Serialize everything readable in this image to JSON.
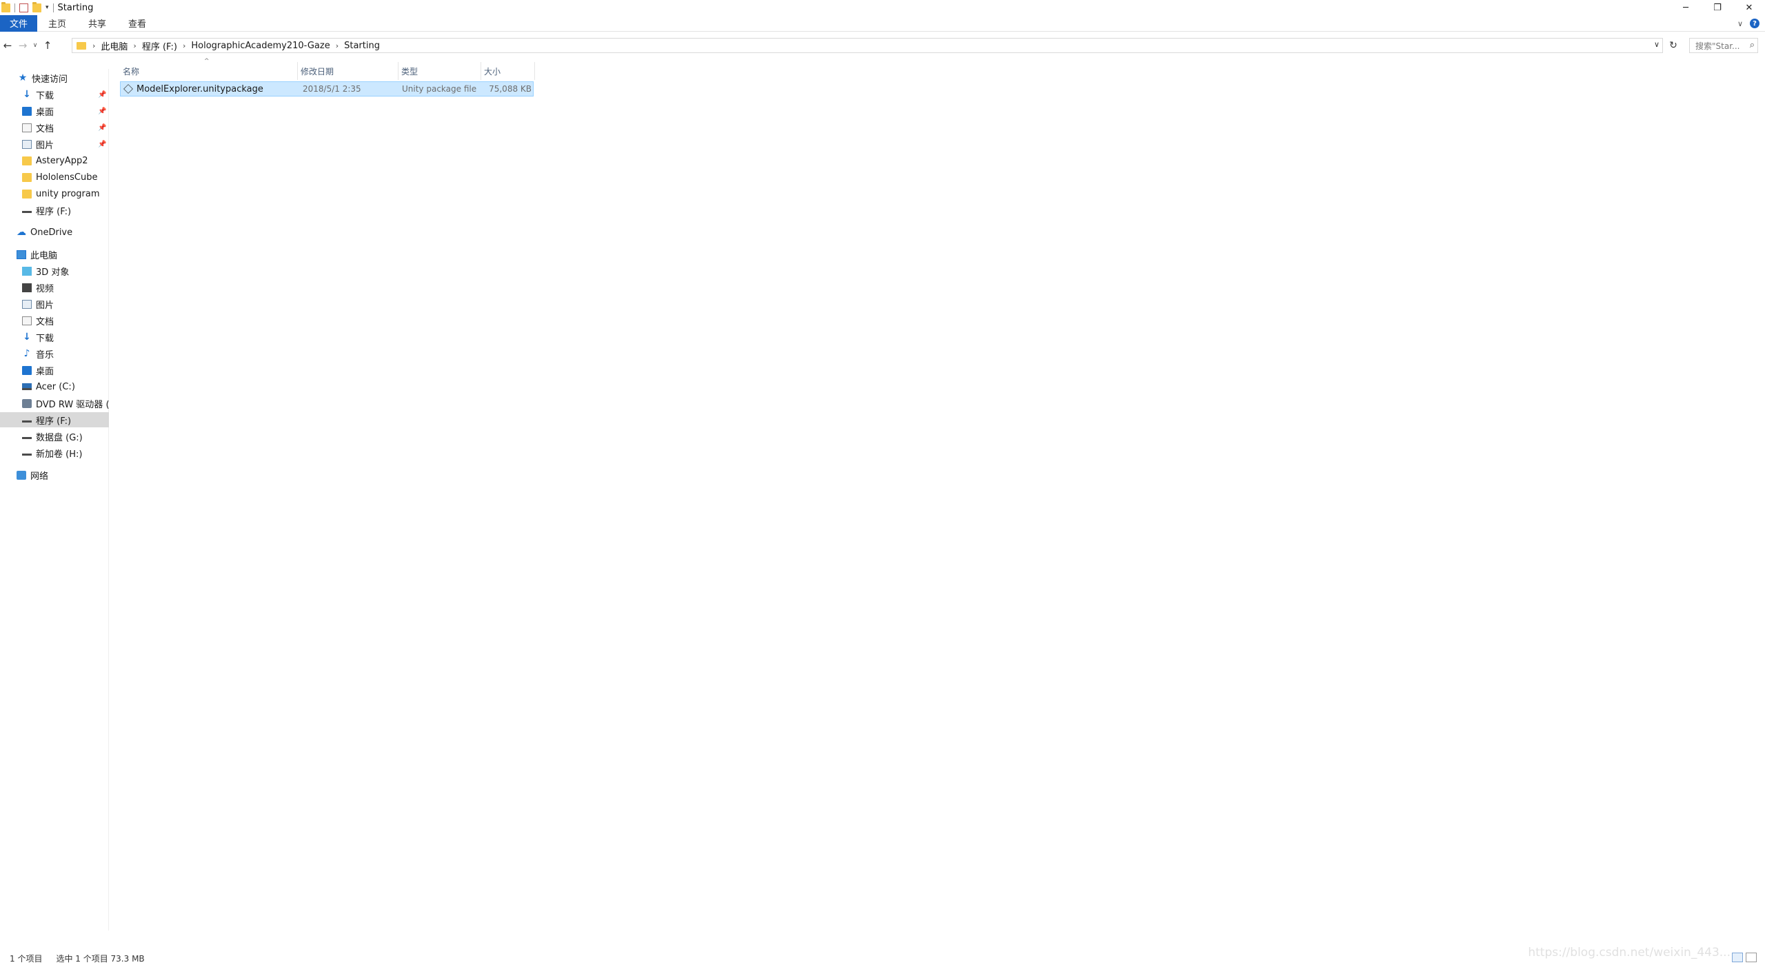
{
  "window": {
    "title": "Starting"
  },
  "ribbon": {
    "tabs": [
      "文件",
      "主页",
      "共享",
      "查看"
    ]
  },
  "address": {
    "crumbs": [
      "此电脑",
      "程序 (F:)",
      "HolographicAcademy210-Gaze",
      "Starting"
    ],
    "search_placeholder": "搜索\"Star..."
  },
  "nav": {
    "quick_access": "快速访问",
    "quick_items": [
      {
        "label": "下载",
        "icon": "download-icon",
        "pinned": true
      },
      {
        "label": "桌面",
        "icon": "desktop-icon",
        "pinned": true
      },
      {
        "label": "文档",
        "icon": "document-icon",
        "pinned": true
      },
      {
        "label": "图片",
        "icon": "picture-icon",
        "pinned": true
      },
      {
        "label": "AsteryApp2",
        "icon": "folder-icon",
        "pinned": false
      },
      {
        "label": "HololensCube",
        "icon": "folder-icon",
        "pinned": false
      },
      {
        "label": "unity program",
        "icon": "folder-icon",
        "pinned": false
      },
      {
        "label": "程序 (F:)",
        "icon": "drive-icon",
        "pinned": false
      }
    ],
    "onedrive": "OneDrive",
    "this_pc": "此电脑",
    "pc_items": [
      {
        "label": "3D 对象",
        "icon": "3d-objects-icon"
      },
      {
        "label": "视频",
        "icon": "video-icon"
      },
      {
        "label": "图片",
        "icon": "picture-icon"
      },
      {
        "label": "文档",
        "icon": "document-icon"
      },
      {
        "label": "下载",
        "icon": "download-icon"
      },
      {
        "label": "音乐",
        "icon": "music-icon"
      },
      {
        "label": "桌面",
        "icon": "desktop-icon"
      },
      {
        "label": "Acer (C:)",
        "icon": "system-drive-icon"
      },
      {
        "label": "DVD RW 驱动器 (D",
        "icon": "dvd-drive-icon"
      },
      {
        "label": "程序 (F:)",
        "icon": "drive-icon",
        "selected": true
      },
      {
        "label": "数据盘 (G:)",
        "icon": "drive-icon"
      },
      {
        "label": "新加卷 (H:)",
        "icon": "drive-icon"
      }
    ],
    "network": "网络"
  },
  "files": {
    "columns": [
      "名称",
      "修改日期",
      "类型",
      "大小"
    ],
    "rows": [
      {
        "name": "ModelExplorer.unitypackage",
        "modified": "2018/5/1 2:35",
        "type": "Unity package file",
        "size": "75,088 KB",
        "selected": true
      }
    ]
  },
  "status": {
    "count": "1 个项目",
    "selection": "选中 1 个项目  73.3 MB"
  },
  "watermark": "https://blog.csdn.net/weixin_443..."
}
